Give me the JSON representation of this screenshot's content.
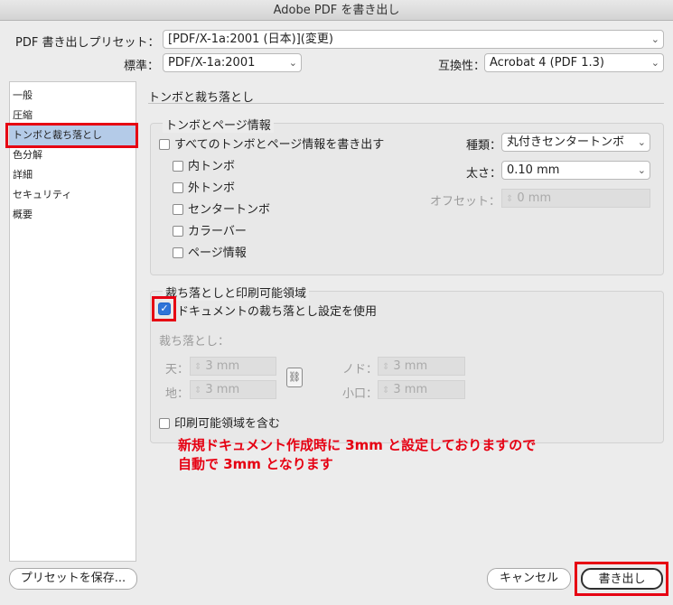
{
  "window": {
    "title": "Adobe PDF を書き出し"
  },
  "preset": {
    "label": "PDF 書き出しプリセット：",
    "value": "[PDF/X-1a:2001 (日本)](変更)"
  },
  "standard": {
    "label": "標準：",
    "value": "PDF/X-1a:2001"
  },
  "compatibility": {
    "label": "互換性：",
    "value": "Acrobat 4 (PDF 1.3)"
  },
  "sidebar": {
    "items": [
      {
        "label": "一般"
      },
      {
        "label": "圧縮"
      },
      {
        "label": "トンボと裁ち落とし",
        "selected": true
      },
      {
        "label": "色分解"
      },
      {
        "label": "詳細"
      },
      {
        "label": "セキュリティ"
      },
      {
        "label": "概要"
      }
    ]
  },
  "main": {
    "section_title": "トンボと裁ち落とし",
    "marks": {
      "legend": "トンボとページ情報",
      "all_marks": "すべてのトンボとページ情報を書き出す",
      "options": [
        "内トンボ",
        "外トンボ",
        "センタートンボ",
        "カラーバー",
        "ページ情報"
      ],
      "type_label": "種類：",
      "type_value": "丸付きセンタートンボ",
      "weight_label": "太さ：",
      "weight_value": "0.10 mm",
      "offset_label": "オフセット：",
      "offset_value": "0 mm"
    },
    "bleed": {
      "legend": "裁ち落としと印刷可能領域",
      "use_doc_bleed": "ドキュメントの裁ち落とし設定を使用",
      "use_doc_bleed_checked": true,
      "bleed_label": "裁ち落とし：",
      "top_label": "天：",
      "top_value": "3 mm",
      "bottom_label": "地：",
      "bottom_value": "3 mm",
      "inside_label": "ノド：",
      "inside_value": "3 mm",
      "outside_label": "小口：",
      "outside_value": "3 mm",
      "slug": "印刷可能領域を含む"
    },
    "note": [
      "新規ドキュメント作成時に 3mm と設定しておりますので",
      "自動で 3mm となります"
    ]
  },
  "footer": {
    "save_preset": "プリセットを保存...",
    "cancel": "キャンセル",
    "export": "書き出し"
  },
  "colors": {
    "accent_red": "#e60012",
    "checkbox_blue": "#2f74d8",
    "sidebar_selected": "#b4cbe8"
  }
}
